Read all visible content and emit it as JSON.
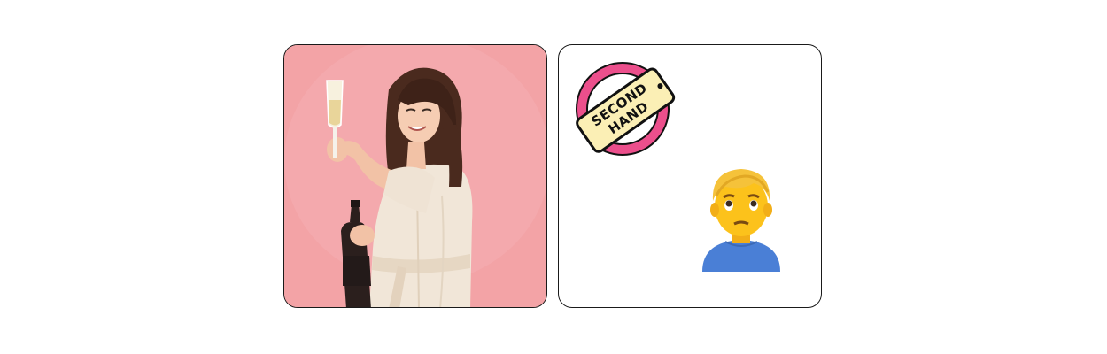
{
  "cards": [
    {
      "id": "celebration-photo",
      "image_icon": "woman-with-champagne-photo",
      "background_color": "#f3a3a6"
    },
    {
      "id": "emoji-panel",
      "background_color": "#ffffff",
      "items": [
        {
          "icon": "second-hand-sticker-icon",
          "line1": "SECOND",
          "line2": "HAND",
          "ring_color": "#ec4f8c",
          "tag_color": "#fbefb5"
        },
        {
          "icon": "man-pouting-emoji-icon",
          "hair_color": "#f5c23a",
          "skin_color": "#fcc21b",
          "shirt_color": "#4a7fd6"
        }
      ]
    }
  ]
}
